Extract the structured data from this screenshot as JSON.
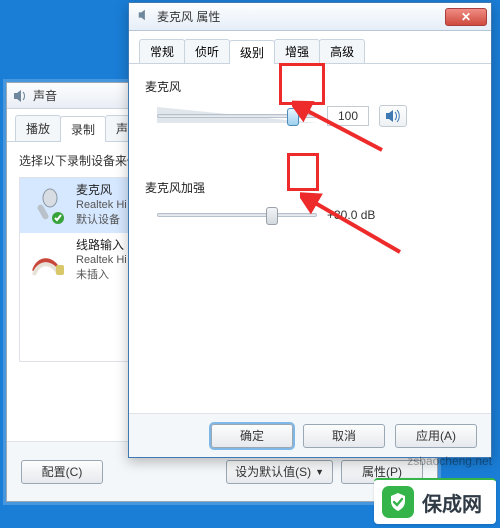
{
  "sound_window": {
    "title": "声音",
    "tabs": {
      "playback": "播放",
      "recording": "录制",
      "sounds": "声音"
    },
    "instruction": "选择以下录制设备来修改",
    "devices": [
      {
        "name": "麦克风",
        "driver": "Realtek Hi",
        "status": "默认设备"
      },
      {
        "name": "线路输入",
        "driver": "Realtek Hi",
        "status": "未插入"
      }
    ],
    "buttons": {
      "configure": "配置(C)",
      "set_default": "设为默认值(S)",
      "properties": "属性(P)"
    }
  },
  "prop_window": {
    "title": "麦克风 属性",
    "tabs": {
      "general": "常规",
      "listen": "侦听",
      "levels": "级别",
      "enhance": "增强",
      "advanced": "高级"
    },
    "level_group": {
      "label": "麦克风",
      "value": "100",
      "percent": 85
    },
    "boost_group": {
      "label": "麦克风加强",
      "value": "+30.0 dB",
      "percent": 72
    },
    "buttons": {
      "ok": "确定",
      "cancel": "取消",
      "apply": "应用(A)"
    }
  },
  "watermark": "zsbaocheng.net",
  "brand": "保成网"
}
